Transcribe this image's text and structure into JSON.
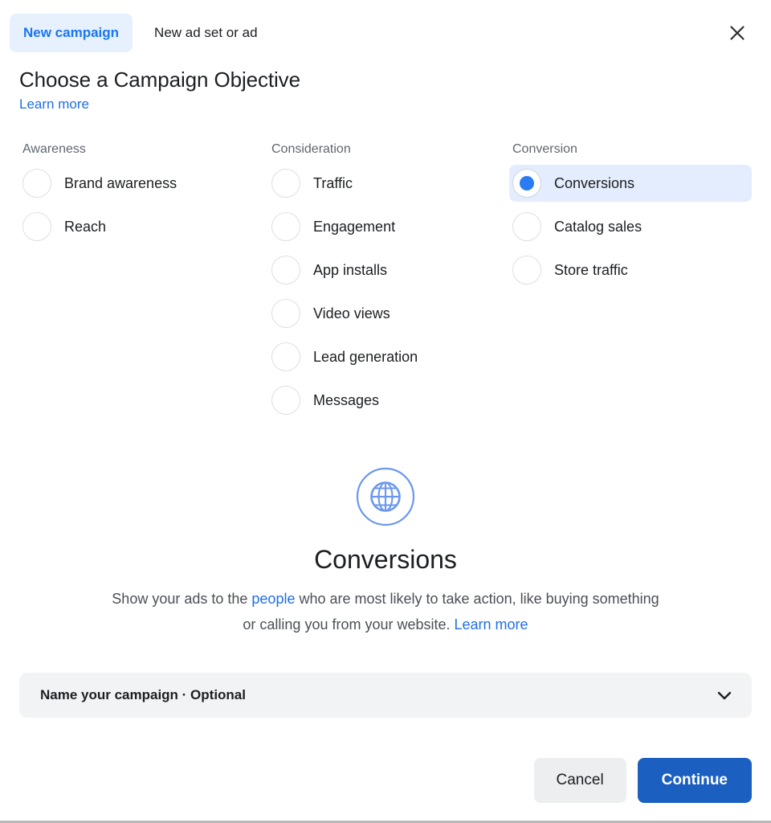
{
  "header": {
    "tabs": [
      {
        "label": "New campaign",
        "active": true
      },
      {
        "label": "New ad set or ad",
        "active": false
      }
    ],
    "close_icon": "close-icon"
  },
  "title": {
    "heading": "Choose a Campaign Objective",
    "learn_more": "Learn more"
  },
  "objectives": {
    "columns": [
      {
        "label": "Awareness",
        "options": [
          {
            "label": "Brand awareness",
            "selected": false
          },
          {
            "label": "Reach",
            "selected": false
          }
        ]
      },
      {
        "label": "Consideration",
        "options": [
          {
            "label": "Traffic",
            "selected": false
          },
          {
            "label": "Engagement",
            "selected": false
          },
          {
            "label": "App installs",
            "selected": false
          },
          {
            "label": "Video views",
            "selected": false
          },
          {
            "label": "Lead generation",
            "selected": false
          },
          {
            "label": "Messages",
            "selected": false
          }
        ]
      },
      {
        "label": "Conversion",
        "options": [
          {
            "label": "Conversions",
            "selected": true
          },
          {
            "label": "Catalog sales",
            "selected": false
          },
          {
            "label": "Store traffic",
            "selected": false
          }
        ]
      }
    ]
  },
  "hero": {
    "icon": "globe-icon",
    "title": "Conversions",
    "description_parts": [
      {
        "text": "Show your ads to the ",
        "link": false
      },
      {
        "text": "people",
        "link": true
      },
      {
        "text": " who are most likely to take action, like buying something or calling you from your website. ",
        "link": false
      },
      {
        "text": "Learn more",
        "link": true
      }
    ]
  },
  "accordion": {
    "label": "Name your campaign · Optional",
    "chevron_icon": "chevron-down-icon"
  },
  "footer": {
    "cancel_label": "Cancel",
    "continue_label": "Continue"
  },
  "colors": {
    "accent_blue": "#1877f2",
    "link_blue": "#1f6fe5",
    "primary_button": "#1b5fc1",
    "selected_row": "#e3edfd",
    "tab_active_bg": "#e7f0fd",
    "radio_dot": "#2b7bf3",
    "hero_icon": "#6b97ee",
    "accordion_bg": "#f2f3f5",
    "cancel_button": "#eceef0"
  }
}
